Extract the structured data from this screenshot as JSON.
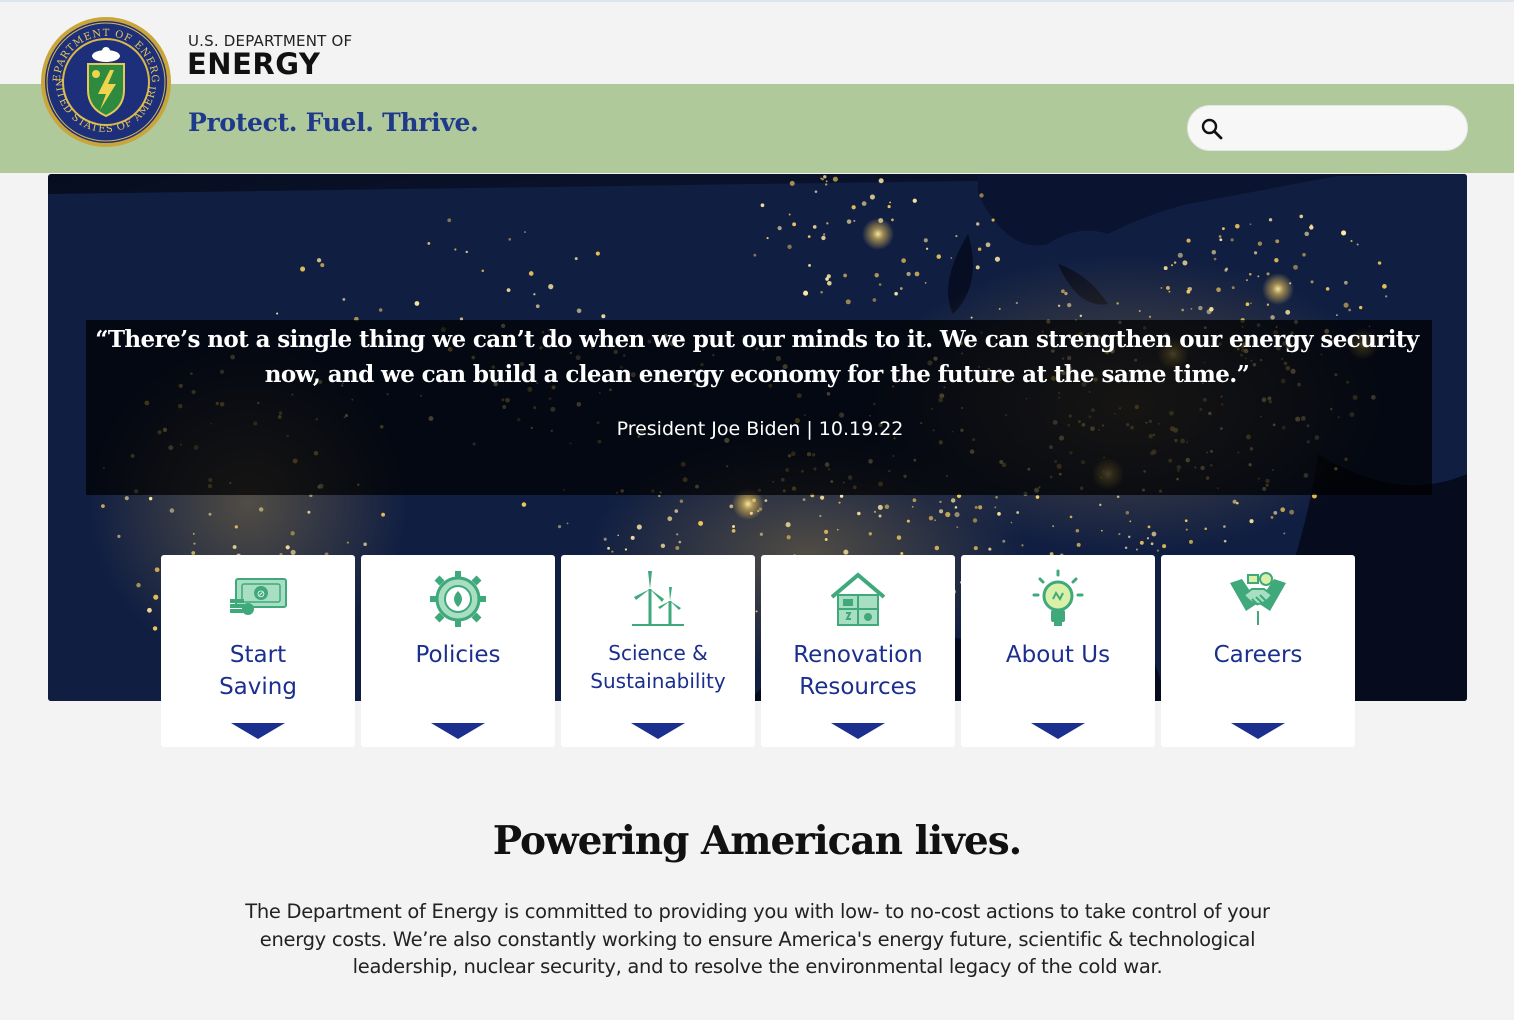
{
  "header": {
    "dept_small": "U.S. DEPARTMENT OF",
    "dept_big": "ENERGY",
    "tagline": "Protect. Fuel. Thrive.",
    "search_placeholder": "",
    "search_icon": "search-icon",
    "seal_text_top": "DEPARTMENT OF ENERGY",
    "seal_text_bottom": "UNITED STATES OF AMERICA"
  },
  "hero": {
    "quote_line1": "“There’s not a single thing we can’t do when we put our minds to it.  We can strengthen our energy security",
    "quote_line2": "now, and we can build a clean energy economy for the future at the same time.”",
    "attribution": "President Joe Biden  |  10.19.22"
  },
  "cards": [
    {
      "label_line1": "Start",
      "label_line2": "Saving",
      "icon": "money-icon"
    },
    {
      "label_line1": "Policies",
      "label_line2": "",
      "icon": "gear-leaf-icon"
    },
    {
      "label_line1": "Science &",
      "label_line2": "Sustainability",
      "icon": "wind-turbine-icon"
    },
    {
      "label_line1": "Renovation",
      "label_line2": "Resources",
      "icon": "house-icon"
    },
    {
      "label_line1": "About Us",
      "label_line2": "",
      "icon": "lightbulb-icon"
    },
    {
      "label_line1": "Careers",
      "label_line2": "",
      "icon": "handshake-icon"
    }
  ],
  "main": {
    "headline": "Powering American lives.",
    "desc_line1": "The Department of Energy is committed to providing you with low- to no-cost actions to take control of your",
    "desc_line2": "energy costs. We’re also constantly working to ensure America's energy future, scientific & technological",
    "desc_line3": "leadership, nuclear security, and to resolve the environmental legacy of the cold war."
  },
  "colors": {
    "green_band": "#b0c99a",
    "brand_blue": "#1b2f8e",
    "icon_green": "#3fa97c",
    "page_bg": "#f3f3f3"
  }
}
